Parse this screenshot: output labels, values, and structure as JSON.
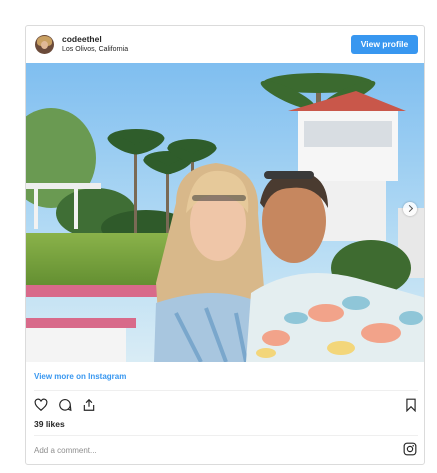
{
  "post": {
    "username": "codeethel",
    "location": "Los Olivos, California",
    "view_profile_label": "View profile",
    "view_more_label": "View more on Instagram",
    "likes_text": "39 likes",
    "comment_placeholder": "Add a comment..."
  },
  "icons": [
    "heart-icon",
    "comment-icon",
    "share-icon",
    "bookmark-icon",
    "instagram-icon",
    "carousel-next-icon"
  ],
  "colors": {
    "accent": "#3897f0",
    "border": "#dbdbdb",
    "text": "#262626",
    "muted": "#8e8e8e"
  }
}
